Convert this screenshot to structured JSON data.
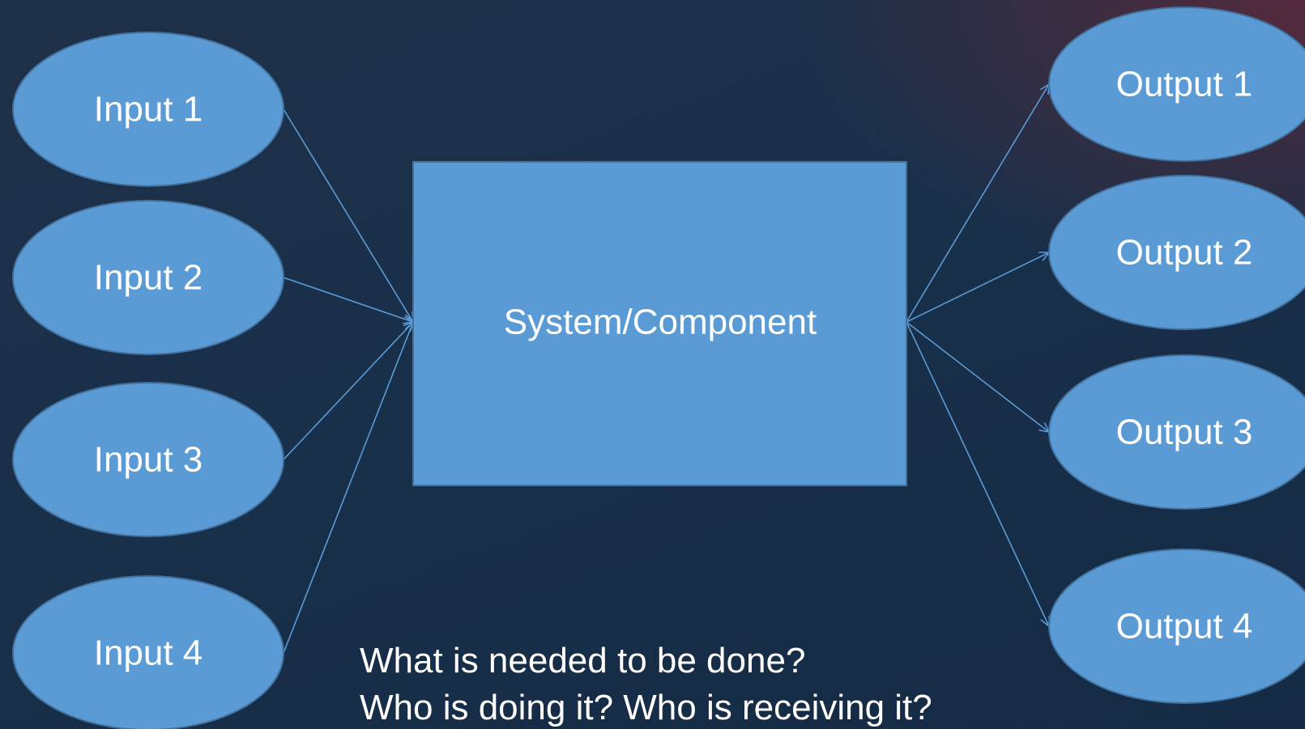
{
  "diagram": {
    "center": {
      "label": "System/Component"
    },
    "inputs": [
      {
        "label": "Input 1"
      },
      {
        "label": "Input 2"
      },
      {
        "label": "Input 3"
      },
      {
        "label": "Input 4"
      }
    ],
    "outputs": [
      {
        "label": "Output 1"
      },
      {
        "label": "Output 2"
      },
      {
        "label": "Output 3"
      },
      {
        "label": "Output 4"
      }
    ],
    "colors": {
      "node_fill": "#5b9bd5",
      "node_stroke": "#41719c",
      "connector": "#5b9bd5",
      "text": "#ffffff"
    }
  },
  "notes": {
    "line1": "What is needed to be done?",
    "line2": "Who is doing it? Who is receiving it?"
  }
}
